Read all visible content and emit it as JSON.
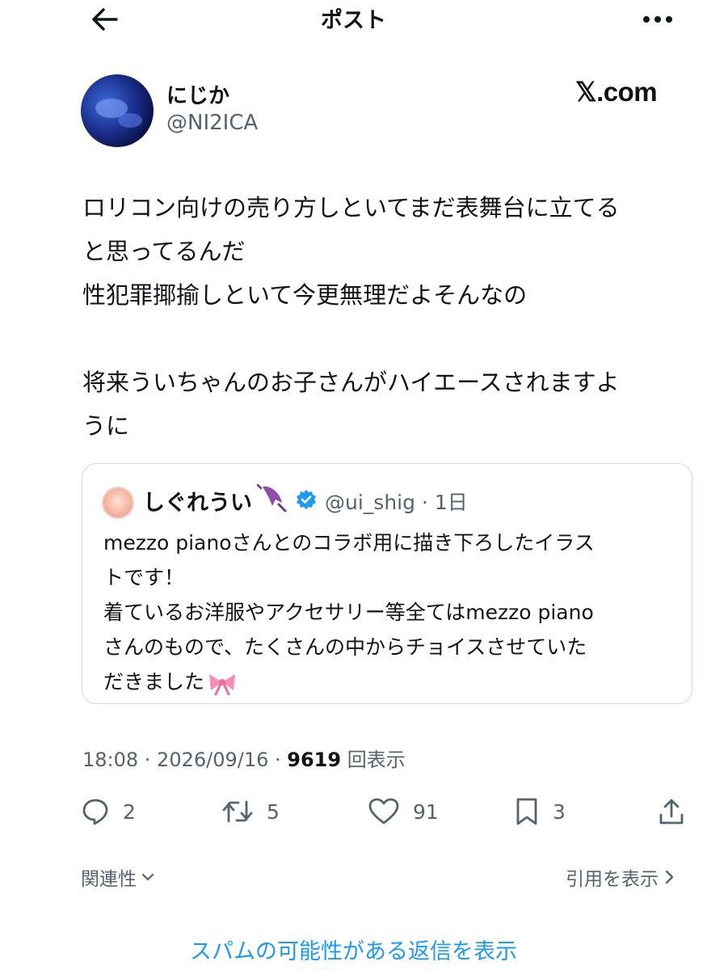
{
  "header": {
    "title": "ポスト",
    "back_icon": "arrow-left-icon",
    "more_icon": "more-horizontal-icon"
  },
  "author": {
    "display_name": "にじか",
    "handle": "@NI2ICA",
    "source_label": "𝕏.com"
  },
  "tweet": {
    "text": "ロリコン向けの売り方しといてまだ表舞台に立てる\nと思ってるんだ\n性犯罪揶揄しといて今更無理だよそんなの\n\n将来ういちゃんのお子さんがハイエースされますよ\nうに"
  },
  "quoted_tweet": {
    "display_name": "しぐれうい",
    "handle_time": "@ui_shig · 1日",
    "text": "mezzo pianoさんとのコラボ用に描き下ろしたイラス\nトです！\n着ているお洋服やアクセサリー等全てはmezzo piano\nさんのもので、たくさんの中からチョイスさせていた\nだきました"
  },
  "meta": {
    "time_date": "18:08 · 2026/09/16 · ",
    "views_count": "9619",
    "views_label": " 回表示"
  },
  "actions": {
    "reply_count": "2",
    "repost_count": "5",
    "like_count": "91",
    "bookmark_count": "3"
  },
  "links": {
    "related": "関連性",
    "view_quotes": "引用を表示",
    "show_spam_replies": "スパムの可能性がある返信を表示"
  },
  "colors": {
    "accent": "#1d9bf0",
    "secondary_text": "#536471",
    "border": "#cfd9de"
  }
}
